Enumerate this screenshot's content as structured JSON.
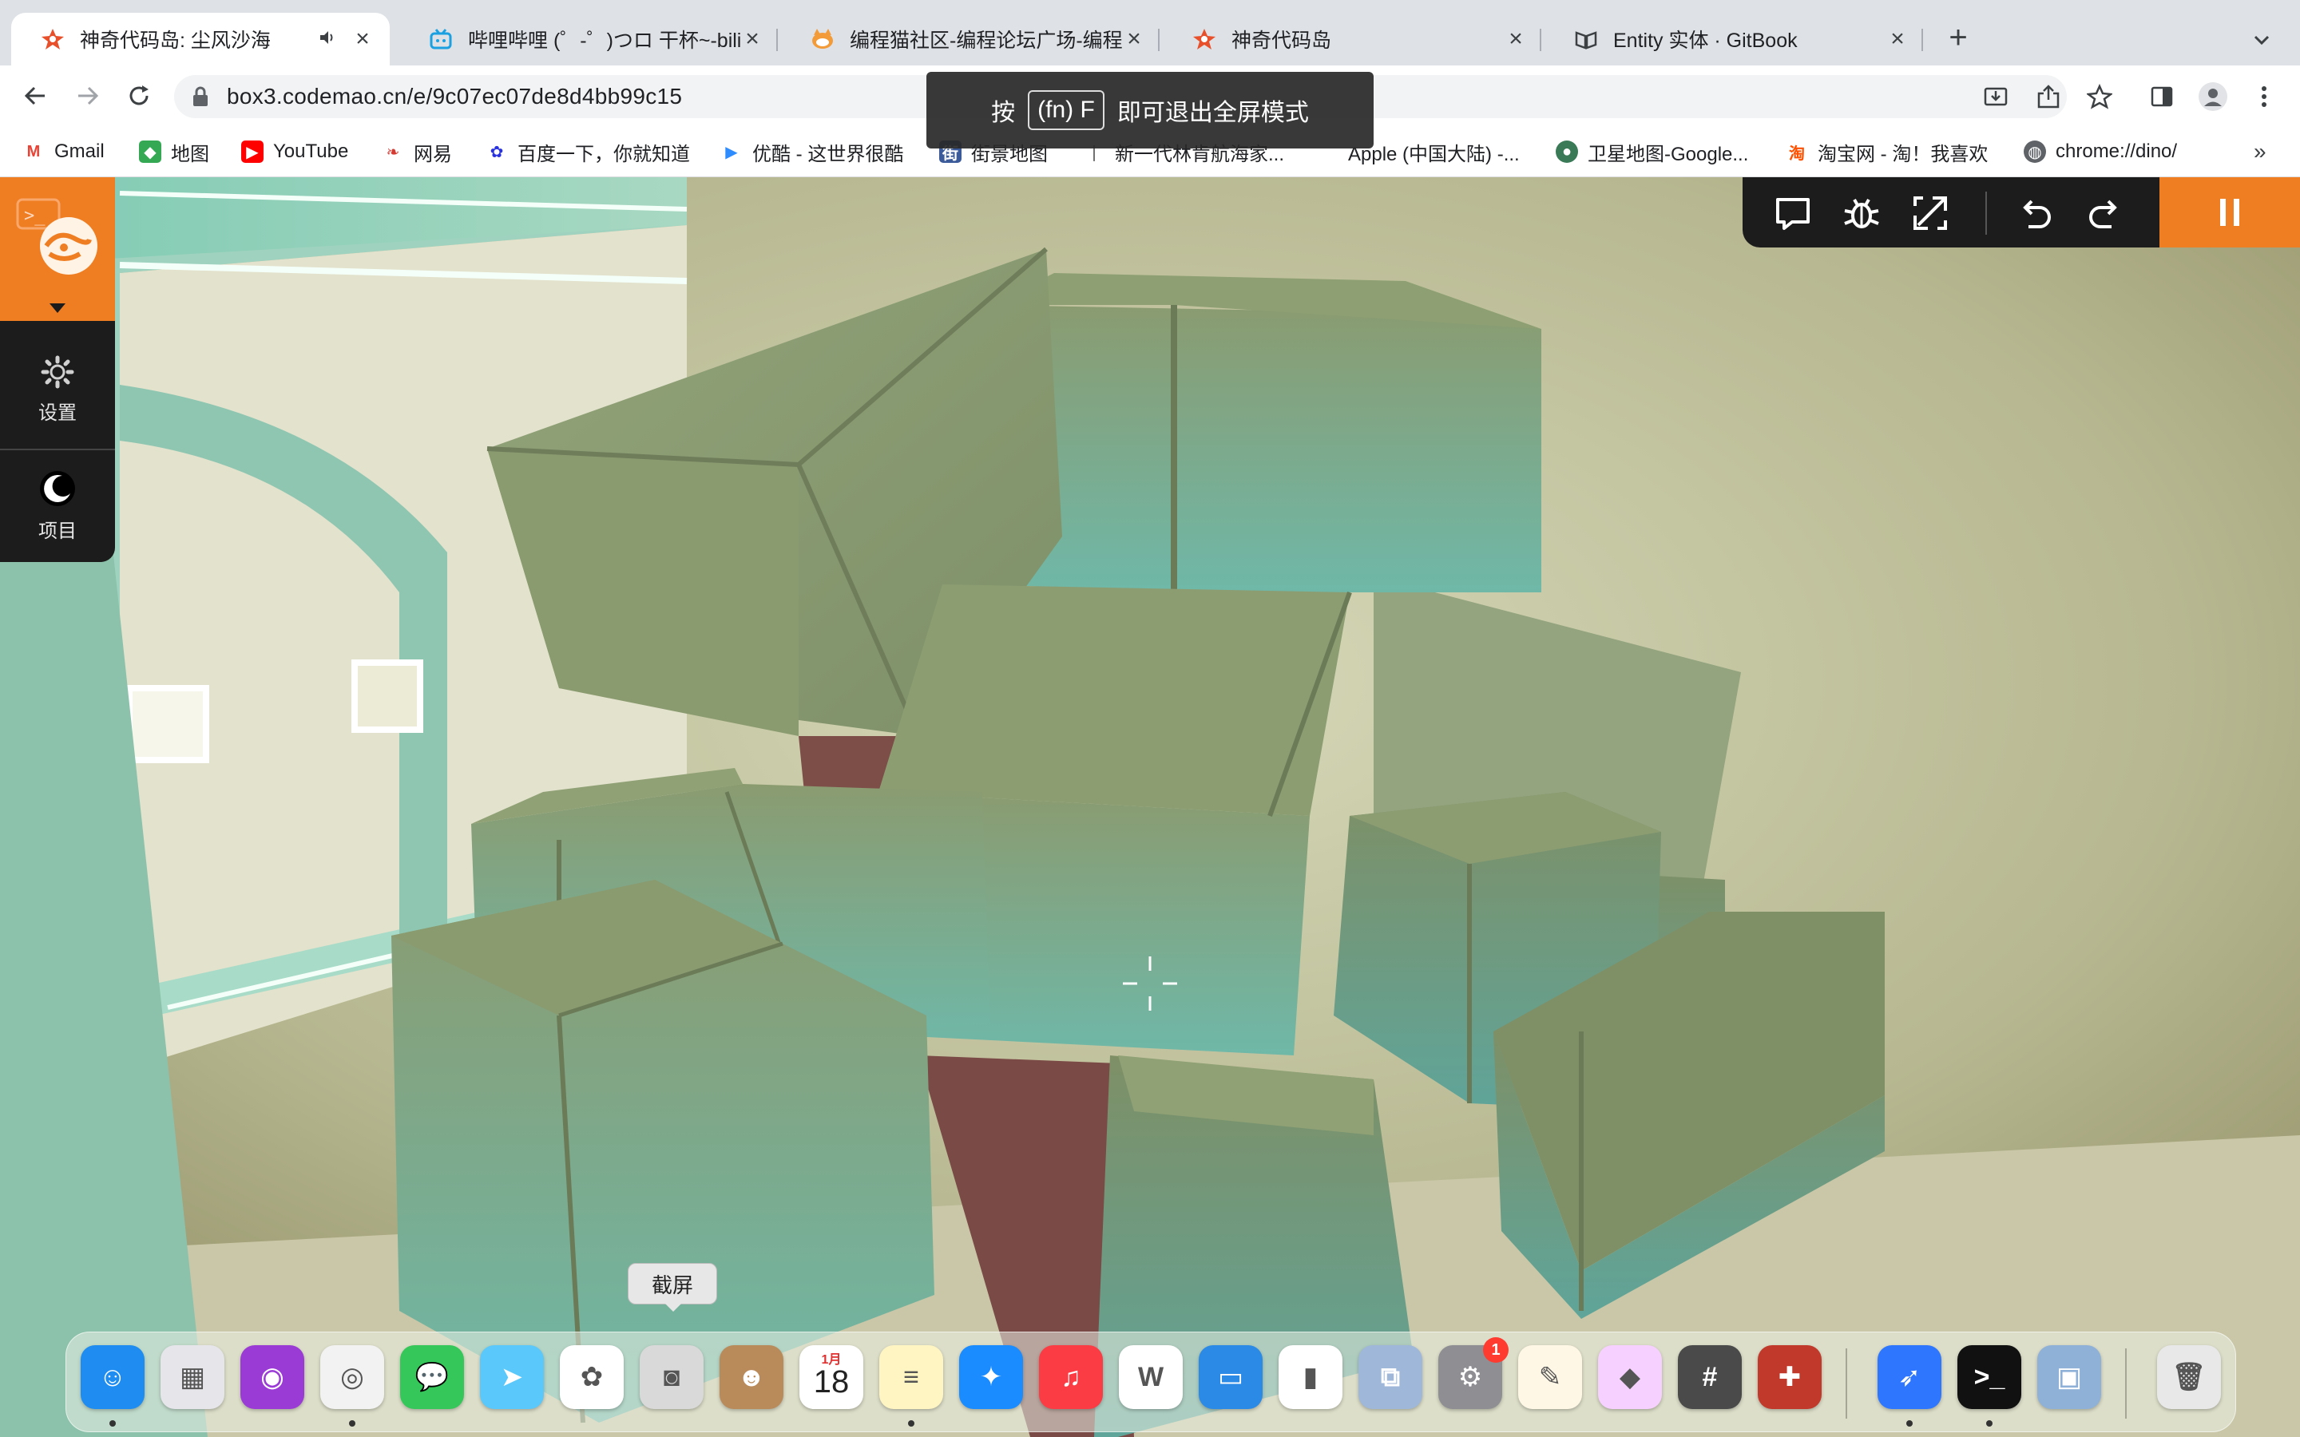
{
  "browser": {
    "tabs": [
      {
        "title": "神奇代码岛: 尘风沙海",
        "active": true,
        "favicon": "codemao-star-icon",
        "audio": true
      },
      {
        "title": "哔哩哔哩 (゜-゜)つロ 干杯~-bilibili",
        "active": false,
        "favicon": "bilibili-tv-icon"
      },
      {
        "title": "编程猫社区-编程论坛广场-编程学习",
        "active": false,
        "favicon": "codemao-cat-icon"
      },
      {
        "title": "神奇代码岛",
        "active": false,
        "favicon": "codemao-star-icon"
      },
      {
        "title": "Entity 实体 · GitBook",
        "active": false,
        "favicon": "gitbook-icon"
      }
    ],
    "url": "box3.codemao.cn/e/9c07ec07de8d4bb99c15",
    "bookmarks": [
      {
        "label": "Gmail",
        "icon": "gmail-icon",
        "color": "#ea4335"
      },
      {
        "label": "地图",
        "icon": "maps-icon",
        "color": "#34a853"
      },
      {
        "label": "YouTube",
        "icon": "youtube-icon",
        "color": "#ff0000"
      },
      {
        "label": "网易",
        "icon": "netease-icon",
        "color": "#d43c33"
      },
      {
        "label": "百度一下，你就知道",
        "icon": "baidu-icon",
        "color": "#2932e1"
      },
      {
        "label": "优酷 - 这世界很酷",
        "icon": "youku-icon",
        "color": "#2f8cff"
      },
      {
        "label": "街景地图",
        "icon": "streetview-icon",
        "color": "#3a5a9a"
      },
      {
        "label": "新一代林肯航海家...",
        "icon": "lincoln-icon",
        "color": "#555555"
      },
      {
        "label": "Apple (中国大陆) -...",
        "icon": "apple-icon",
        "color": "#666666"
      },
      {
        "label": "卫星地图-Google...",
        "icon": "earth-icon",
        "color": "#3b7a57"
      },
      {
        "label": "淘宝网 - 淘！我喜欢",
        "icon": "taobao-icon",
        "color": "#ff5000"
      },
      {
        "label": "chrome://dino/",
        "icon": "globe-icon",
        "color": "#5f6368"
      }
    ],
    "fullscreen_toast": {
      "prefix": "按",
      "key": "(fn) F",
      "suffix": "即可退出全屏模式"
    }
  },
  "game": {
    "side_menu": {
      "settings_label": "设置",
      "project_label": "项目"
    },
    "accent_color": "#ef7d22"
  },
  "dock": {
    "tooltip": "截屏",
    "calendar": {
      "month": "1月",
      "day": "18"
    },
    "settings_badge": "1",
    "apps": [
      {
        "name": "finder-icon",
        "color": "#1e8cf0",
        "glyph": "☺"
      },
      {
        "name": "launchpad-icon",
        "color": "#e5e5ea",
        "glyph": "▦"
      },
      {
        "name": "podcasts-icon",
        "color": "#9b3bd6",
        "glyph": "◉"
      },
      {
        "name": "chrome-icon",
        "color": "#f2f2f2",
        "glyph": "◎"
      },
      {
        "name": "messages-icon",
        "color": "#35c759",
        "glyph": "💬"
      },
      {
        "name": "maps-icon",
        "color": "#5ac8fa",
        "glyph": "➤"
      },
      {
        "name": "photos-icon",
        "color": "#ffffff",
        "glyph": "✿"
      },
      {
        "name": "screenshot-icon",
        "color": "#d9d9d9",
        "glyph": "◙"
      },
      {
        "name": "contacts-icon",
        "color": "#b98a5a",
        "glyph": "☻"
      },
      {
        "name": "calendar-icon",
        "color": "#ffffff",
        "glyph": ""
      },
      {
        "name": "notes-icon",
        "color": "#fff5c2",
        "glyph": "≡"
      },
      {
        "name": "safari-icon",
        "color": "#1a8cff",
        "glyph": "✦"
      },
      {
        "name": "music-icon",
        "color": "#fc3c44",
        "glyph": "♫"
      },
      {
        "name": "wps-icon",
        "color": "#ffffff",
        "glyph": "W"
      },
      {
        "name": "keynote-icon",
        "color": "#2a8ae6",
        "glyph": "▭"
      },
      {
        "name": "numbers-icon",
        "color": "#ffffff",
        "glyph": "▮"
      },
      {
        "name": "screen-sharing-icon",
        "color": "#9fb7d9",
        "glyph": "⧉"
      },
      {
        "name": "system-preferences-icon",
        "color": "#8e8e93",
        "glyph": "⚙"
      },
      {
        "name": "pages-icon",
        "color": "#fff7e6",
        "glyph": "✎"
      },
      {
        "name": "pixelmator-icon",
        "color": "#f6d0ff",
        "glyph": "◆"
      },
      {
        "name": "calculator-icon",
        "color": "#4a4a4a",
        "glyph": "#"
      },
      {
        "name": "instruments-icon",
        "color": "#c0392b",
        "glyph": "✚"
      },
      {
        "name": "feishu-icon",
        "color": "#2f76ff",
        "glyph": "➶"
      },
      {
        "name": "terminal-icon",
        "color": "#111111",
        "glyph": ">_"
      },
      {
        "name": "preview-icon",
        "color": "#8fb1d8",
        "glyph": "▣"
      },
      {
        "name": "trash-icon",
        "color": "#e8e8e8",
        "glyph": "🗑"
      }
    ]
  }
}
